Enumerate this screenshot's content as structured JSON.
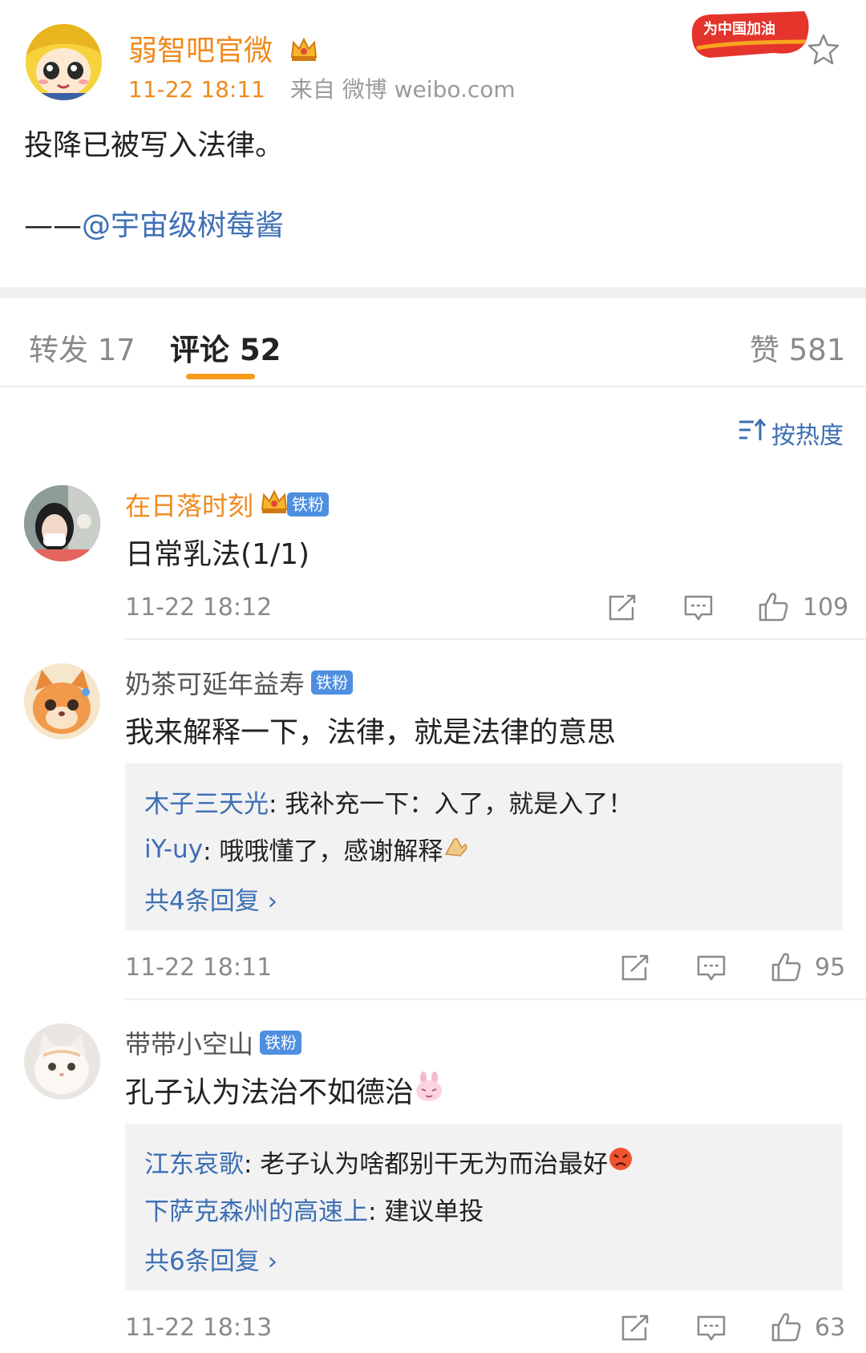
{
  "post": {
    "author": "弱智吧官微",
    "time": "11-22 18:11",
    "source": "来自 微博 weibo.com",
    "promo_badge": "为中国加油",
    "body": "投降已被写入法律。",
    "mention_prefix": "——",
    "mention": "@宇宙级树莓酱"
  },
  "tabs": {
    "repost": "转发 17",
    "comment": "评论 52",
    "like": "赞 581"
  },
  "sort": {
    "label": "按热度",
    "icon": "sort-up-icon"
  },
  "comments": [
    {
      "user": "在日落时刻",
      "badge": "铁粉",
      "text": "日常乳法(1/1)",
      "time": "11-22 18:12",
      "likes": "109"
    },
    {
      "user": "奶茶可延年益寿",
      "badge": "铁粉",
      "text": "我来解释一下，法律，就是法律的意思",
      "time": "11-22 18:11",
      "likes": "95",
      "replies": [
        {
          "who": "木子三天光",
          "text": ": 我补充一下：入了，就是入了！"
        },
        {
          "who": "iY-uy",
          "text": ": 哦哦懂了，感谢解释"
        }
      ],
      "more": "共4条回复 ›"
    },
    {
      "user": "带带小空山",
      "badge": "铁粉",
      "text": "孔子认为法治不如德治",
      "time": "11-22 18:13",
      "likes": "63",
      "replies": [
        {
          "who": "江东哀歌",
          "text": ": 老子认为啥都别干无为而治最好"
        },
        {
          "who": "下萨克森州的高速上",
          "text": ": 建议单投"
        }
      ],
      "more": "共6条回复 ›"
    }
  ],
  "colors": {
    "accent_orange": "#f08a1c",
    "link_blue": "#3d6fb4",
    "fan_badge_blue": "#4e8fe0"
  }
}
